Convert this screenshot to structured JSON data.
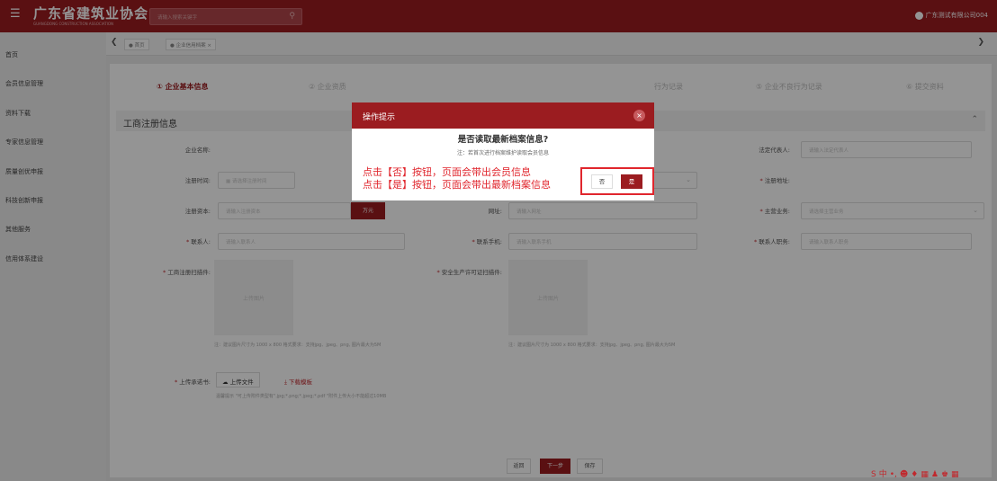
{
  "header": {
    "logo_title": "广东省建筑业协会",
    "logo_subtitle": "GUANGDONG CONSTRUCTION ASSOCIATION",
    "search_placeholder": "请输入搜索关键字",
    "user_name": "广东测试有限公司004",
    "menu_icon": "menu-icon",
    "search_icon": "search-icon"
  },
  "sidebar": {
    "items": [
      {
        "label": "首页"
      },
      {
        "label": "会员信息管理"
      },
      {
        "label": "资料下载"
      },
      {
        "label": "专家信息管理"
      },
      {
        "label": "质量创优申报"
      },
      {
        "label": "科技创新申报"
      },
      {
        "label": "其他服务"
      },
      {
        "label": "信用体系建设"
      }
    ]
  },
  "tabs": {
    "items": [
      {
        "label": "首页"
      },
      {
        "label": "企业信用档案"
      }
    ],
    "close_glyph": "×"
  },
  "steps": [
    {
      "label": "① 企业基本信息"
    },
    {
      "label": "② 企业资质"
    },
    {
      "label": "行为记录"
    },
    {
      "label": "⑤ 企业不良行为记录"
    },
    {
      "label": "⑥ 提交资料"
    }
  ],
  "section": {
    "title": "工商注册信息"
  },
  "form": {
    "company_name_label": "企业名称:",
    "legal_rep_label": "法定代表人:",
    "legal_rep_placeholder": "请输入法定代表人",
    "reg_time_label": "注册时间:",
    "reg_time_placeholder": "请选择注册时间",
    "reg_address_label": "注册地址:",
    "reg_capital_label": "注册资本:",
    "reg_capital_placeholder": "请输入注册资本",
    "capital_unit": "万元",
    "website_label": "网址:",
    "website_placeholder": "请输入网址",
    "main_business_label": "主营业务:",
    "main_business_placeholder": "请选择主营业务",
    "contact_label": "联系人:",
    "contact_placeholder": "请输入联系人",
    "contact_phone_label": "联系手机:",
    "contact_phone_placeholder": "请输入联系手机",
    "contact_title_label": "联系人职务:",
    "contact_title_placeholder": "请输入联系人职务",
    "biz_license_label": "工商注册扫描件:",
    "safety_license_label": "安全生产许可证扫描件:",
    "upload_image_text": "上传图片",
    "upload_tip": "注：建议图片尺寸为 1000 x 800 格式要求：支持jpg、jpeg、png, 图片最大为5M",
    "commitment_label": "上传承诺书:",
    "upload_file_button": "上传文件",
    "download_template_link": "下载模板",
    "commitment_tip": "温馨提示 \"可上传附件类型有\".jpg;*.png;*.jpeg;*.pdf \"附件上传大小不能超过10MB"
  },
  "bottom_buttons": {
    "back": "返回",
    "next": "下一步",
    "save": "保存"
  },
  "modal": {
    "title": "操作提示",
    "close_glyph": "×",
    "question": "是否读取最新档案信息?",
    "note": "注：若首次进行档案维护读取会员信息",
    "no_button": "否",
    "yes_button": "是"
  },
  "annotation": {
    "line1": "点击【否】按钮，页面会带出会员信息",
    "line2": "点击【是】按钮，页面会带出最新档案信息"
  },
  "ime_toolbar": {
    "items": [
      "S",
      "中",
      "•,",
      "☻",
      "♦",
      "▦",
      "♟",
      "♚",
      "▦"
    ]
  },
  "colors": {
    "brand": "#9b1c20",
    "annotation": "#e0262d"
  }
}
